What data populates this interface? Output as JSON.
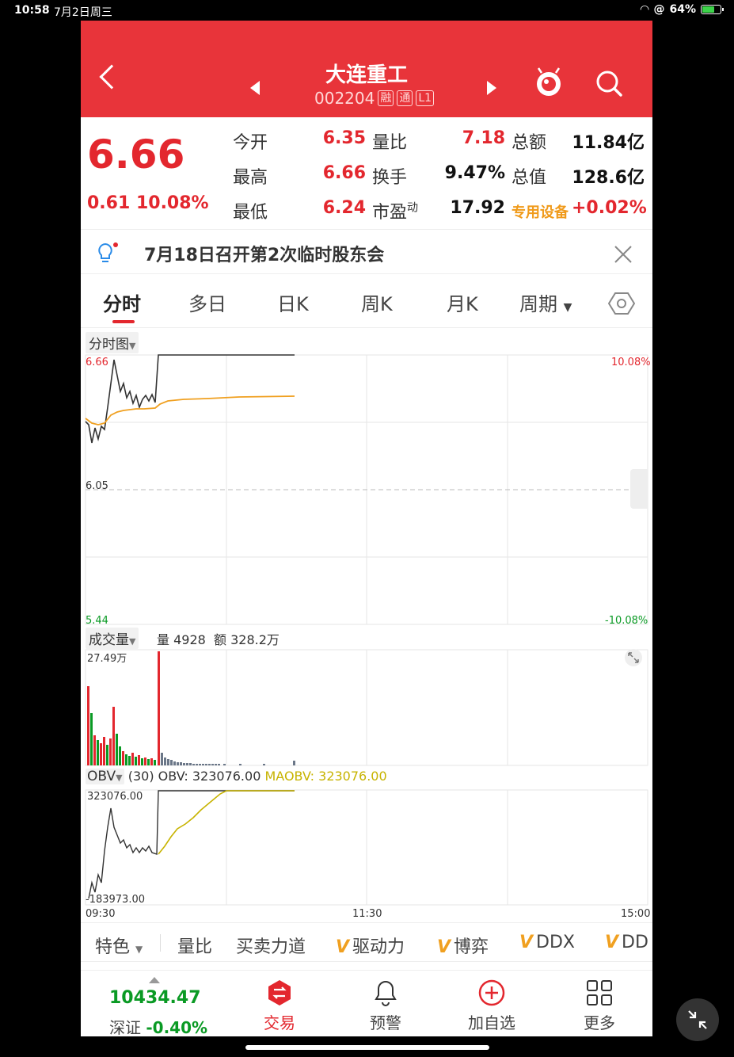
{
  "status": {
    "time": "10:58",
    "date": "7月2日周三",
    "battery": "64%"
  },
  "header": {
    "title": "大连重工",
    "code": "002204",
    "tags": [
      "融",
      "通",
      "L1"
    ]
  },
  "quote": {
    "price": "6.66",
    "change": "0.61",
    "change_pct": "10.08%",
    "rows": [
      {
        "k1": "今开",
        "v1": "6.35",
        "k2": "量比",
        "v2": "7.18",
        "k3": "总额",
        "v3": "11.84亿"
      },
      {
        "k1": "最高",
        "v1": "6.66",
        "k2": "换手",
        "v2": "9.47%",
        "k3": "总值",
        "v3": "128.6亿"
      },
      {
        "k1": "最低",
        "v1": "6.24",
        "k2": "市盈",
        "k2sup": "动",
        "v2": "17.92",
        "k3": "专用设备",
        "v3": "+0.02%"
      }
    ]
  },
  "notice": {
    "text": "7月18日召开第2次临时股东会"
  },
  "tabs": [
    {
      "label": "分时",
      "active": true
    },
    {
      "label": "多日"
    },
    {
      "label": "日K"
    },
    {
      "label": "周K"
    },
    {
      "label": "月K"
    },
    {
      "label": "周期"
    }
  ],
  "price_chart": {
    "selector": "分时图",
    "top_price": "6.66",
    "mid_price": "6.05",
    "bottom_price": "5.44",
    "top_pct": "10.08%",
    "bottom_pct": "-10.08%"
  },
  "volume": {
    "selector": "成交量",
    "vol_label": "量",
    "vol": "4928",
    "amt_label": "额",
    "amt": "328.2万",
    "max": "27.49万"
  },
  "obv": {
    "selector": "OBV",
    "param": "(30)",
    "obv_label": "OBV: 323076.00",
    "maobv_label": "MAOBV: 323076.00",
    "top": "323076.00",
    "bottom": "-183973.00"
  },
  "time_axis": {
    "start": "09:30",
    "mid": "11:30",
    "end": "15:00"
  },
  "indicators": [
    {
      "label": "特色",
      "dropdown": true
    },
    {
      "label": "量比"
    },
    {
      "label": "买卖力道"
    },
    {
      "label": "驱动力",
      "vip": true
    },
    {
      "label": "博弈",
      "vip": true
    },
    {
      "label": "DDX",
      "vip": true
    },
    {
      "label": "DD",
      "vip": true
    }
  ],
  "bottom_nav": {
    "index_value": "10434.47",
    "index_name": "深证",
    "index_change": "-0.40%",
    "items": [
      {
        "label": "交易"
      },
      {
        "label": "预警"
      },
      {
        "label": "加自选"
      },
      {
        "label": "更多"
      }
    ]
  },
  "colors": {
    "brand": "#e8343a",
    "up": "#e3272e",
    "down": "#0a9a24",
    "avg": "#f0a020"
  }
}
